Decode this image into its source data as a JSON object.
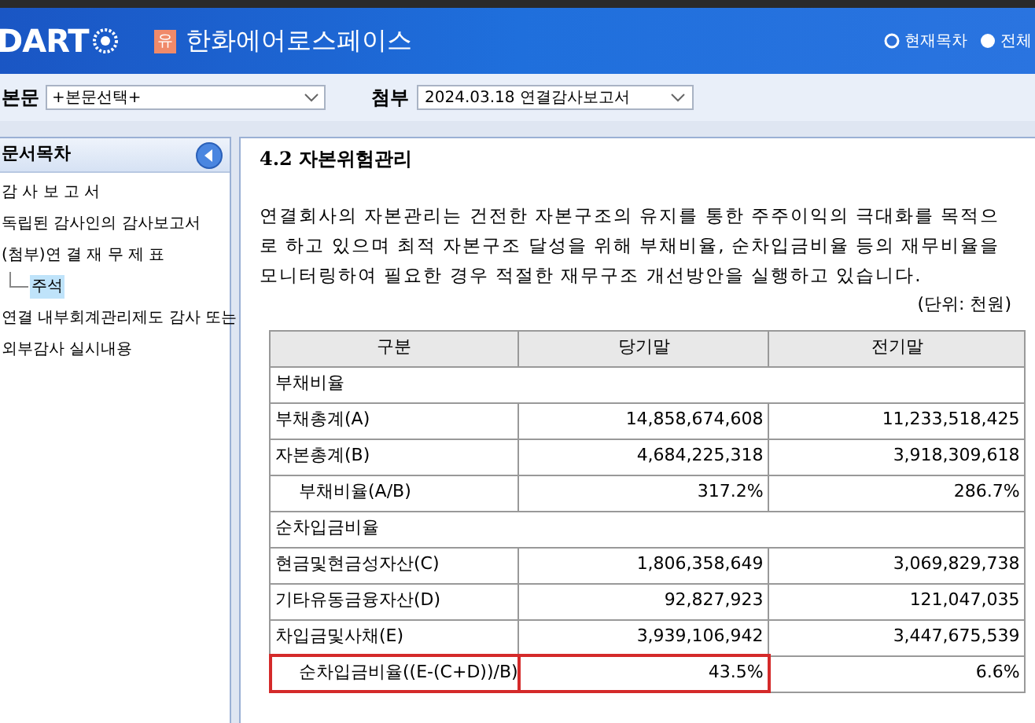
{
  "header": {
    "logo": "DART",
    "company_badge": "유",
    "company": "한화에어로스페이스",
    "toc_options": [
      {
        "label": "현재목차",
        "selected": true
      },
      {
        "label": "전체",
        "selected": false
      }
    ]
  },
  "toolbar": {
    "body_label": "본문",
    "body_select": "+본문선택+",
    "attach_label": "첨부",
    "attach_select": "2024.03.18  연결감사보고서"
  },
  "sidebar": {
    "title": "문서목차",
    "items": [
      {
        "label": "감 사 보 고 서",
        "selected": false
      },
      {
        "label": "독립된 감사인의 감사보고서",
        "selected": false
      },
      {
        "label": "(첨부)연 결 재 무 제 표",
        "selected": false,
        "children": [
          {
            "label": "주석",
            "selected": true
          }
        ]
      },
      {
        "label": "연결 내부회계관리제도 감사 또는",
        "selected": false
      },
      {
        "label": "외부감사 실시내용",
        "selected": false
      }
    ]
  },
  "content": {
    "heading": "4.2 자본위험관리",
    "paragraph": "연결회사의 자본관리는 건전한 자본구조의 유지를 통한 주주이익의 극대화를 목적으로 하고 있으며 최적 자본구조 달성을 위해 부채비율, 순차입금비율 등의 재무비율을 모니터링하여 필요한 경우 적절한 재무구조 개선방안을 실행하고 있습니다.",
    "unit": "(단위: 천원)",
    "table": {
      "columns": [
        "구분",
        "당기말",
        "전기말"
      ],
      "rows": [
        {
          "kind": "section",
          "label": "부채비율"
        },
        {
          "kind": "data",
          "label": "부채총계(A)",
          "current": "14,858,674,608",
          "prior": "11,233,518,425",
          "highlighted": false
        },
        {
          "kind": "data",
          "label": "자본총계(B)",
          "current": "4,684,225,318",
          "prior": "3,918,309,618",
          "highlighted": false
        },
        {
          "kind": "ratio",
          "label": "부채비율(A/B)",
          "current": "317.2%",
          "prior": "286.7%",
          "highlighted": false
        },
        {
          "kind": "section",
          "label": "순차입금비율"
        },
        {
          "kind": "data",
          "label": "현금및현금성자산(C)",
          "current": "1,806,358,649",
          "prior": "3,069,829,738",
          "highlighted": false
        },
        {
          "kind": "data",
          "label": "기타유동금융자산(D)",
          "current": "92,827,923",
          "prior": "121,047,035",
          "highlighted": false
        },
        {
          "kind": "data",
          "label": "차입금및사채(E)",
          "current": "3,939,106,942",
          "prior": "3,447,675,539",
          "highlighted": false
        },
        {
          "kind": "ratio",
          "label": "순차입금비율((E-(C+D))/B)",
          "current": "43.5%",
          "prior": "6.6%",
          "highlighted": true
        }
      ]
    }
  }
}
